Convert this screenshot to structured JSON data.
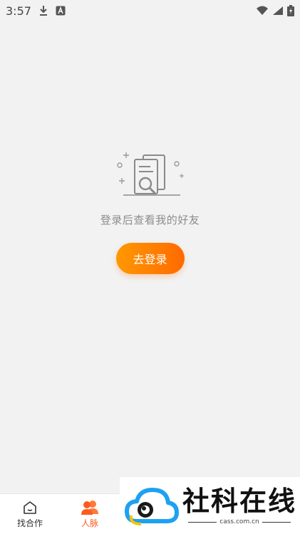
{
  "status_bar": {
    "time": "3:57",
    "icons": [
      "download-icon",
      "font-a-icon",
      "wifi-icon",
      "signal-icon",
      "battery-icon"
    ]
  },
  "empty_state": {
    "message": "登录后查看我的好友",
    "login_button_label": "去登录"
  },
  "bottom_nav": {
    "items": [
      {
        "label": "找合作",
        "icon": "home-icon",
        "active": false
      },
      {
        "label": "人脉",
        "icon": "people-icon",
        "active": true
      }
    ]
  },
  "watermark": {
    "title": "社科在线",
    "subtitle": "cass.com.cn"
  },
  "colors": {
    "accent": "#ff6a00",
    "accent_start": "#ff9800",
    "active_nav": "#ff5a1f",
    "background": "#f2f2f2",
    "watermark_blue": "#1da1f2"
  }
}
